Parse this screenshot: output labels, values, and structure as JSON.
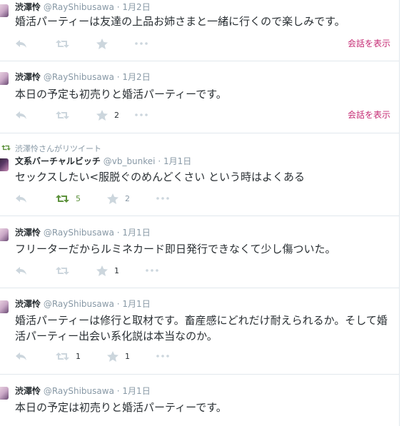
{
  "tweets": [
    {
      "name": "渋澤怜",
      "handle": "@RayShibusawa",
      "dot": "·",
      "time": "1月2日",
      "text": "婚活パーティーは友達の上品お姉さまと一緒に行くので楽しみです。",
      "retweet_count": "",
      "favorite_count": "",
      "conversation": "会話を表示"
    },
    {
      "name": "渋澤怜",
      "handle": "@RayShibusawa",
      "dot": "·",
      "time": "1月2日",
      "text": "本日の予定も初売りと婚活パーティーです。",
      "retweet_count": "",
      "favorite_count": "2",
      "conversation": "会話を表示"
    },
    {
      "retweet_label": "渋澤怜さんがリツイート",
      "name": "文系バーチャルビッチ",
      "handle": "@vb_bunkei",
      "dot": "·",
      "time": "1月1日",
      "text": "セックスしたい<服脱ぐのめんどくさい という時はよくある",
      "retweet_count": "5",
      "favorite_count": "2",
      "conversation": ""
    },
    {
      "name": "渋澤怜",
      "handle": "@RayShibusawa",
      "dot": "·",
      "time": "1月1日",
      "text": "フリーターだからルミネカード即日発行できなくて少し傷ついた。",
      "retweet_count": "",
      "favorite_count": "1",
      "conversation": ""
    },
    {
      "name": "渋澤怜",
      "handle": "@RayShibusawa",
      "dot": "·",
      "time": "1月1日",
      "text": "婚活パーティーは修行と取材です。畜産感にどれだけ耐えられるか。そして婚活パーティー出会い系化説は本当なのか。",
      "retweet_count": "1",
      "favorite_count": "1",
      "conversation": ""
    },
    {
      "name": "渋澤怜",
      "handle": "@RayShibusawa",
      "dot": "·",
      "time": "1月1日",
      "text": "本日の予定は初売りと婚活パーティーです。",
      "retweet_count": "",
      "favorite_count": "",
      "conversation": ""
    }
  ],
  "icons": {
    "reply": "reply-icon",
    "retweet": "retweet-icon",
    "favorite": "star-icon",
    "more": "more-icon"
  },
  "colors": {
    "text": "#292f33",
    "muted": "#8899a6",
    "conversation": "#c52a73",
    "retweeted": "#5c913b",
    "border": "#e1e8ed"
  }
}
